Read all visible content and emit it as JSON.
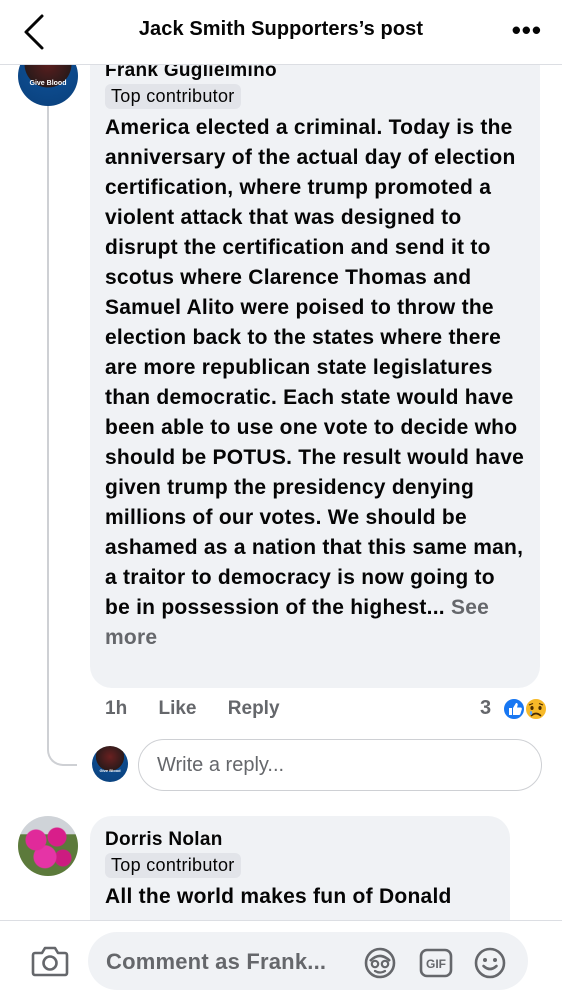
{
  "header": {
    "title": "Jack Smith Supporters’s post",
    "back_icon": "chevron-left-icon",
    "more_icon": "more-horizontal-icon",
    "more_label": "•••"
  },
  "comments": [
    {
      "author": "Frank Guglielmino",
      "avatar_text": "Give Blood",
      "badge": "Top contributor",
      "text": "America elected a criminal. Today is the anniversary of the actual day of election certification, where trump promoted a violent attack that was designed to disrupt the certification and send it to scotus where Clarence Thomas and Samuel Alito were poised to throw the election back to the states where there are more republican state legislatures than democratic. Each state would have been able to use one vote to decide who should be POTUS. The result would have given trump the presidency denying millions of our votes. We should be ashamed as a nation that this same man, a traitor to democracy is now going to be in possession of the highest...",
      "see_more": "See more",
      "time": "1h",
      "like_label": "Like",
      "reply_label": "Reply",
      "reaction_count": "3",
      "reactions": [
        "like",
        "sad"
      ]
    },
    {
      "author": "Dorris Nolan",
      "badge": "Top contributor",
      "text": "All the world makes fun of Donald"
    }
  ],
  "reply_box": {
    "avatar_text": "Give Blood",
    "placeholder": "Write a reply..."
  },
  "composer": {
    "placeholder": "Comment as Frank...",
    "camera_icon": "camera-icon",
    "avatar_sticker_icon": "avatar-sticker-icon",
    "gif_label": "GIF",
    "emoji_icon": "emoji-icon"
  },
  "colors": {
    "bubble": "#f0f2f5",
    "secondary_text": "#65676b",
    "like_blue": "#1877f2",
    "sad_yellow": "#f7b928"
  }
}
